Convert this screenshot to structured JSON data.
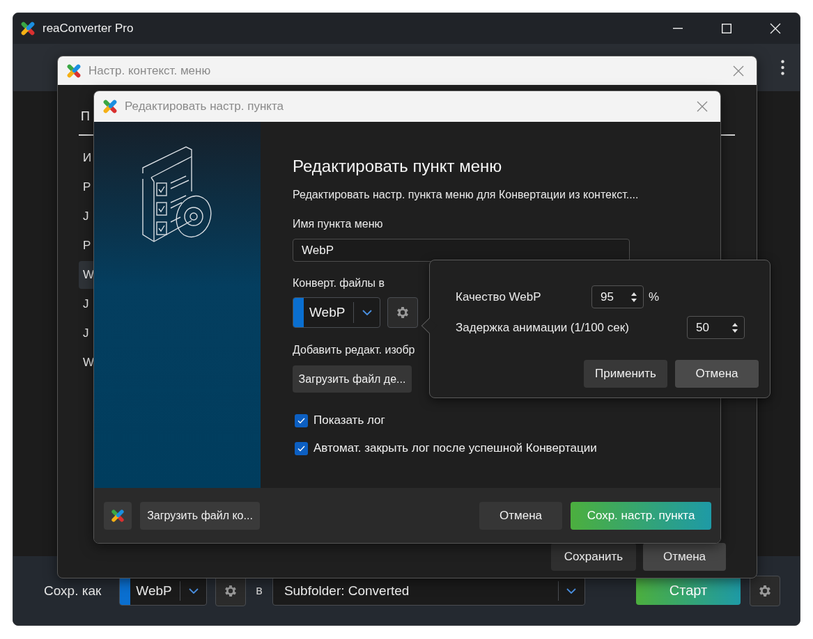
{
  "main_window": {
    "title": "reaConverter Pro",
    "save_bar": {
      "save_as_label": "Сохр. как",
      "format": "WebP",
      "in_label": "в",
      "destination": "Subfolder: Converted",
      "start_button": "Старт"
    }
  },
  "context_menu_dialog": {
    "title": "Настр. контекст. меню",
    "tab": "П",
    "items": [
      {
        "label": "И",
        "selected": false
      },
      {
        "label": "P",
        "selected": false
      },
      {
        "label": "J",
        "selected": false
      },
      {
        "label": "P",
        "selected": false
      },
      {
        "label": "W",
        "selected": true
      },
      {
        "label": "J",
        "selected": false
      },
      {
        "label": "J",
        "selected": false
      },
      {
        "label": "W",
        "selected": false
      }
    ],
    "buttons": [
      "Сохранить",
      "Отмена"
    ]
  },
  "edit_dialog": {
    "title": "Редактировать настр. пункта",
    "heading": "Редактировать пункт меню",
    "description": "Редактировать настр. пункта меню для Конвертации из контекст....",
    "name_label": "Имя пункта меню",
    "name_value": "WebP",
    "convert_label": "Конверт. файлы в",
    "format": "WebP",
    "add_edit_label": "Добавить редакт. изобр",
    "load_edit_button": "Загрузить файл де...",
    "options": [
      {
        "label": "Показать лог",
        "checked": true
      },
      {
        "label": "Автомат. закрыть лог после успешной Конвертации",
        "checked": true
      }
    ],
    "load_config_button": "Загрузить файл ко...",
    "cancel_button": "Отмена",
    "save_button": "Сохр. настр. пункта"
  },
  "format_settings_popover": {
    "fields": [
      {
        "label": "Качество WebP",
        "value": "95",
        "unit": "%"
      },
      {
        "label": "Задержка анимации (1/100 сек)",
        "value": "50"
      }
    ],
    "apply_button": "Применить",
    "cancel_button": "Отмена"
  }
}
